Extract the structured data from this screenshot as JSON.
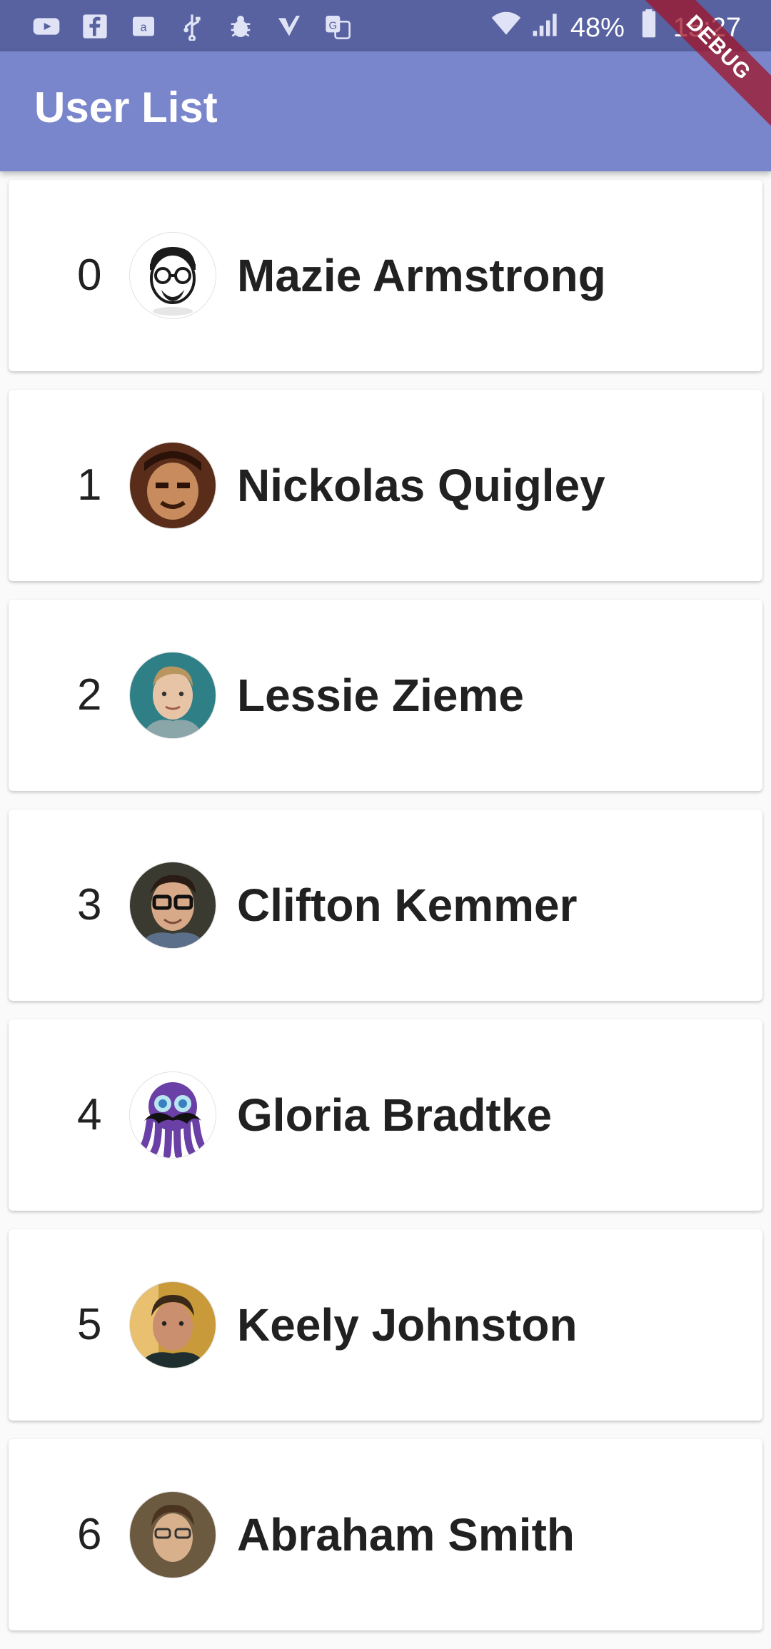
{
  "status_bar": {
    "left_icons": [
      "youtube-icon",
      "facebook-icon",
      "amazon-icon",
      "usb-icon",
      "bug-icon",
      "check-icon",
      "translate-icon"
    ],
    "battery_percent": "48%",
    "time": "15:27"
  },
  "app_bar": {
    "title": "User List"
  },
  "debug_banner": {
    "label": "DEBUG"
  },
  "users": [
    {
      "index": "0",
      "name": "Mazie Armstrong",
      "avatar_icon": "cartoon-glasses-beard-avatar"
    },
    {
      "index": "1",
      "name": "Nickolas Quigley",
      "avatar_icon": "photo-avatar"
    },
    {
      "index": "2",
      "name": "Lessie Zieme",
      "avatar_icon": "photo-avatar"
    },
    {
      "index": "3",
      "name": "Clifton Kemmer",
      "avatar_icon": "photo-avatar"
    },
    {
      "index": "4",
      "name": "Gloria Bradtke",
      "avatar_icon": "octopus-avatar"
    },
    {
      "index": "5",
      "name": "Keely Johnston",
      "avatar_icon": "photo-avatar"
    },
    {
      "index": "6",
      "name": "Abraham Smith",
      "avatar_icon": "photo-avatar"
    }
  ]
}
